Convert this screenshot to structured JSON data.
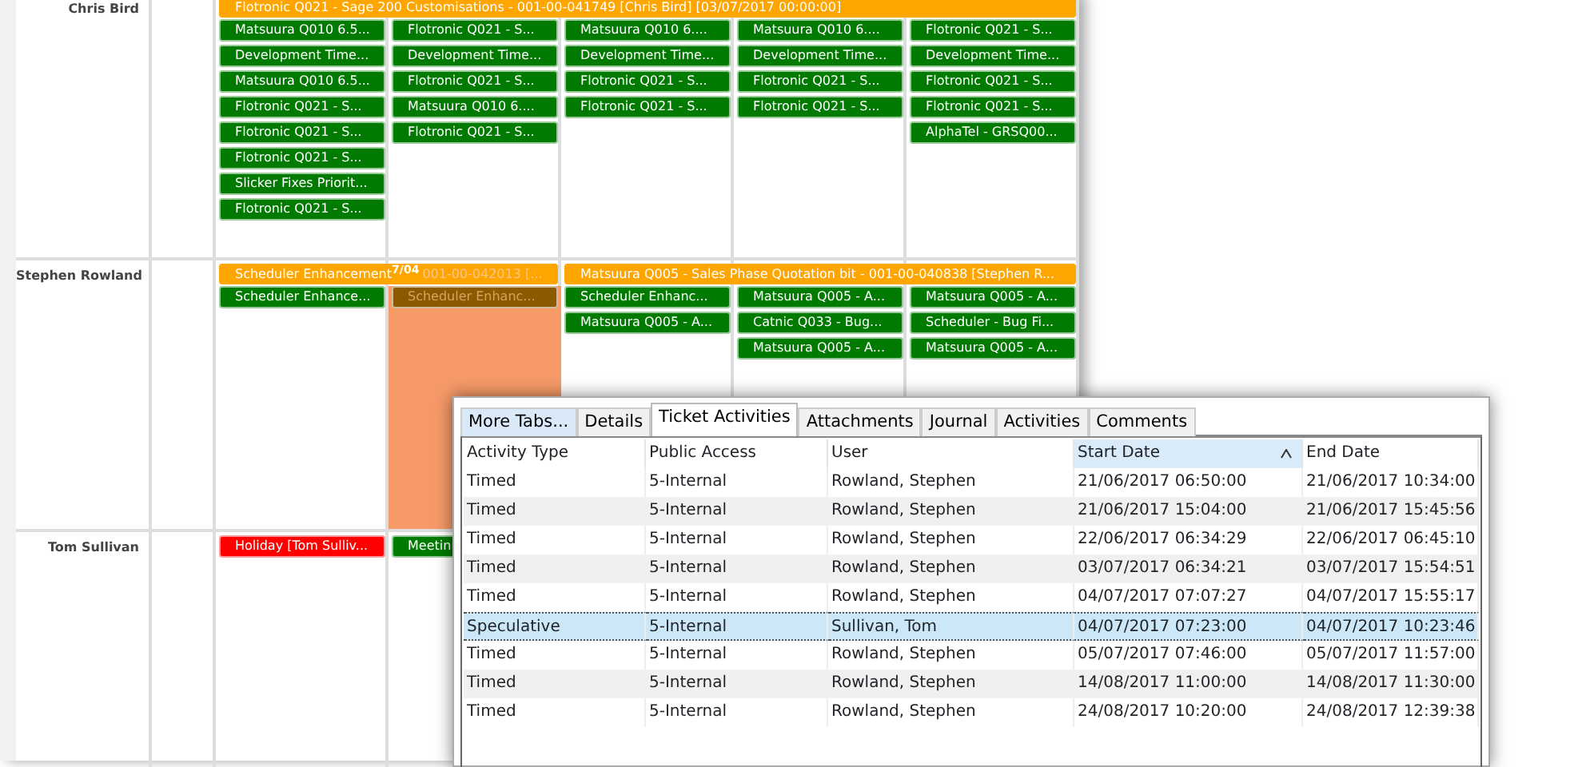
{
  "scheduler": {
    "people": [
      {
        "name": "Chris Bird",
        "days": [
          {
            "selected": false,
            "bars": [
              {
                "kind": "project",
                "text": "Flotronic Q021 - Sage 200 Customisations - 001-00-041749 [Chris Bird] [03/07/2017 00:00:00]"
              }
            ],
            "items": [
              {
                "kind": "task",
                "text": "Matsuura Q010 6.5..."
              },
              {
                "kind": "task",
                "text": "Development Time..."
              },
              {
                "kind": "task",
                "text": "Matsuura Q010 6.5..."
              },
              {
                "kind": "task",
                "text": "Flotronic Q021 - S..."
              },
              {
                "kind": "task",
                "text": "Flotronic Q021 - S..."
              },
              {
                "kind": "task",
                "text": "Flotronic Q021 - S..."
              },
              {
                "kind": "task",
                "text": "Slicker Fixes Priorit..."
              },
              {
                "kind": "task",
                "text": "Flotronic Q021 - S..."
              }
            ]
          },
          {
            "selected": false,
            "items": [
              {
                "kind": "task",
                "text": "Flotronic Q021 - S..."
              },
              {
                "kind": "task",
                "text": "Development Time..."
              },
              {
                "kind": "task",
                "text": "Flotronic Q021 - S..."
              },
              {
                "kind": "task",
                "text": "Matsuura Q010 6...."
              },
              {
                "kind": "task",
                "text": "Flotronic Q021 - S..."
              }
            ]
          },
          {
            "selected": false,
            "items": [
              {
                "kind": "task",
                "text": "Matsuura Q010 6...."
              },
              {
                "kind": "task",
                "text": "Development Time..."
              },
              {
                "kind": "task",
                "text": "Flotronic Q021 - S..."
              },
              {
                "kind": "task",
                "text": "Flotronic Q021 - S..."
              }
            ]
          },
          {
            "selected": false,
            "items": [
              {
                "kind": "task",
                "text": "Matsuura Q010 6...."
              },
              {
                "kind": "task",
                "text": "Development Time..."
              },
              {
                "kind": "task",
                "text": "Flotronic Q021 - S..."
              },
              {
                "kind": "task",
                "text": "Flotronic Q021 - S..."
              }
            ]
          },
          {
            "selected": false,
            "items": [
              {
                "kind": "task",
                "text": "Flotronic Q021 - S..."
              },
              {
                "kind": "task",
                "text": "Development Time..."
              },
              {
                "kind": "task",
                "text": "Flotronic Q021 - S..."
              },
              {
                "kind": "task",
                "text": "Flotronic Q021 - S..."
              },
              {
                "kind": "task",
                "text": "AlphaTel - GRSQ00..."
              }
            ]
          }
        ]
      },
      {
        "name": "Stephen Rowland",
        "days": [
          {
            "selected": false,
            "bars": [
              {
                "kind": "project",
                "text": "Scheduler Enhancement",
                "tag": "7/04",
                "rest": "001-00-042013 [..."
              }
            ],
            "items": [
              {
                "kind": "task",
                "text": "Scheduler Enhance..."
              }
            ]
          },
          {
            "selected": true,
            "items": [
              {
                "kind": "faded",
                "text": "Scheduler Enhanc..."
              }
            ]
          },
          {
            "selected": false,
            "bars": [
              {
                "kind": "project",
                "text": "Matsuura Q005 - Sales Phase Quotation bit - 001-00-040838 [Stephen R..."
              }
            ],
            "items": [
              {
                "kind": "task",
                "text": "Scheduler Enhanc..."
              },
              {
                "kind": "task",
                "text": "Matsuura Q005 - A..."
              }
            ]
          },
          {
            "selected": false,
            "items": [
              {
                "kind": "task",
                "text": "Matsuura Q005 - A..."
              },
              {
                "kind": "task",
                "text": "Catnic Q033 - Bug..."
              },
              {
                "kind": "task",
                "text": "Matsuura Q005 - A..."
              }
            ]
          },
          {
            "selected": false,
            "items": [
              {
                "kind": "task",
                "text": "Matsuura Q005 - A..."
              },
              {
                "kind": "task",
                "text": "Scheduler - Bug Fi..."
              },
              {
                "kind": "task",
                "text": "Matsuura Q005 - A..."
              }
            ]
          }
        ]
      },
      {
        "name": "Tom Sullivan",
        "days": [
          {
            "selected": false,
            "items": [
              {
                "kind": "holiday",
                "text": "Holiday [Tom Sulliv..."
              }
            ]
          },
          {
            "selected": false,
            "items": [
              {
                "kind": "task",
                "text": "Meetin"
              }
            ]
          }
        ]
      }
    ]
  },
  "dialog": {
    "tabs": [
      {
        "label": "More Tabs...",
        "kind": "more",
        "selected": false
      },
      {
        "label": "Details",
        "kind": "tab",
        "selected": false
      },
      {
        "label": "Ticket Activities",
        "kind": "tab",
        "selected": true
      },
      {
        "label": "Attachments",
        "kind": "tab",
        "selected": false
      },
      {
        "label": "Journal",
        "kind": "tab",
        "selected": false
      },
      {
        "label": "Activities",
        "kind": "tab",
        "selected": false
      },
      {
        "label": "Comments",
        "kind": "tab",
        "selected": false
      }
    ],
    "table": {
      "columns": [
        {
          "label": "Activity Type",
          "sorted": false
        },
        {
          "label": "Public Access",
          "sorted": false
        },
        {
          "label": "User",
          "sorted": false
        },
        {
          "label": "Start Date",
          "sorted": true
        },
        {
          "label": "End Date",
          "sorted": false
        }
      ],
      "rows": [
        {
          "selected": false,
          "cells": [
            "Timed",
            "5-Internal",
            "Rowland, Stephen",
            "21/06/2017 06:50:00",
            "21/06/2017 10:34:00"
          ]
        },
        {
          "selected": false,
          "cells": [
            "Timed",
            "5-Internal",
            "Rowland, Stephen",
            "21/06/2017 15:04:00",
            "21/06/2017 15:45:56"
          ]
        },
        {
          "selected": false,
          "cells": [
            "Timed",
            "5-Internal",
            "Rowland, Stephen",
            "22/06/2017 06:34:29",
            "22/06/2017 06:45:10"
          ]
        },
        {
          "selected": false,
          "cells": [
            "Timed",
            "5-Internal",
            "Rowland, Stephen",
            "03/07/2017 06:34:21",
            "03/07/2017 15:54:51"
          ]
        },
        {
          "selected": false,
          "cells": [
            "Timed",
            "5-Internal",
            "Rowland, Stephen",
            "04/07/2017 07:07:27",
            "04/07/2017 15:55:17"
          ]
        },
        {
          "selected": true,
          "cells": [
            "Speculative",
            "5-Internal",
            "Sullivan, Tom",
            "04/07/2017 07:23:00",
            "04/07/2017 10:23:46"
          ]
        },
        {
          "selected": false,
          "cells": [
            "Timed",
            "5-Internal",
            "Rowland, Stephen",
            "05/07/2017 07:46:00",
            "05/07/2017 11:57:00"
          ]
        },
        {
          "selected": false,
          "cells": [
            "Timed",
            "5-Internal",
            "Rowland, Stephen",
            "14/08/2017 11:00:00",
            "14/08/2017 11:30:00"
          ]
        },
        {
          "selected": false,
          "cells": [
            "Timed",
            "5-Internal",
            "Rowland, Stephen",
            "24/08/2017 10:20:00",
            "24/08/2017 12:39:38"
          ]
        }
      ]
    }
  }
}
